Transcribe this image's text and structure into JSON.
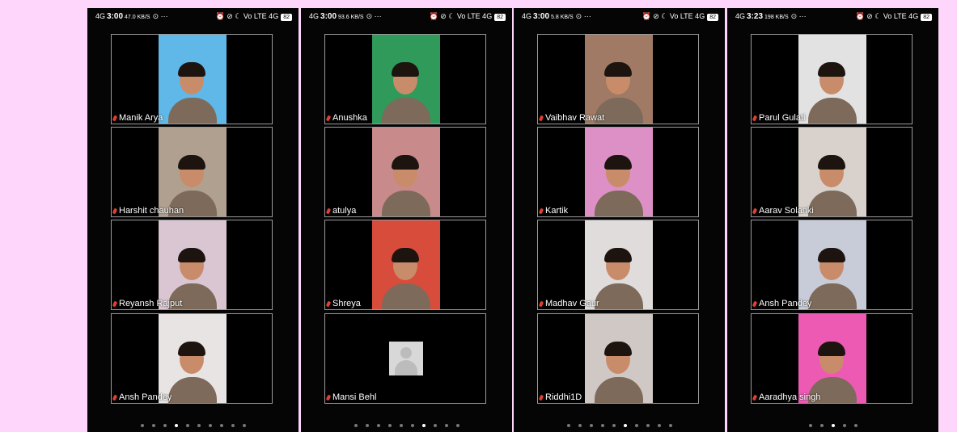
{
  "screens": [
    {
      "status": {
        "network": "4G",
        "time": "3:00",
        "speed": "47.0 KB/S",
        "extra": "⊙ ···",
        "right_icons": "⏰ ⊘ ☾ Vo LTE 4G",
        "battery": "82"
      },
      "tiles": [
        {
          "name": "Manik  Arya",
          "bg": "#5fb8e8"
        },
        {
          "name": "Harshit chauhan",
          "bg": "#b0a090"
        },
        {
          "name": "Reyansh Rajput",
          "bg": "#d9c6d2"
        },
        {
          "name": "Ansh Pandey",
          "bg": "#e8e4e4"
        }
      ],
      "dots": {
        "count": 10,
        "active": 3
      }
    },
    {
      "status": {
        "network": "4G",
        "time": "3:00",
        "speed": "93.6 KB/S",
        "extra": "⊙ ···",
        "right_icons": "⏰ ⊘ ☾ Vo LTE 4G",
        "battery": "82"
      },
      "tiles": [
        {
          "name": "Anushka",
          "bg": "#2f9a5a"
        },
        {
          "name": "atulya",
          "bg": "#c88a8a"
        },
        {
          "name": "Shreya",
          "bg": "#d84c3c"
        },
        {
          "name": "Mansi Behl",
          "bg": null
        }
      ],
      "dots": {
        "count": 10,
        "active": 6
      }
    },
    {
      "status": {
        "network": "4G",
        "time": "3:00",
        "speed": "5.8 KB/S",
        "extra": "⊙ ···",
        "right_icons": "⏰ ⊘ ☾ Vo LTE 4G",
        "battery": "82"
      },
      "tiles": [
        {
          "name": "Vaibhav Rawat",
          "bg": "#a07a64"
        },
        {
          "name": "Kartik",
          "bg": "#dd90c6"
        },
        {
          "name": "Madhav Gaur",
          "bg": "#e0dcdc"
        },
        {
          "name": "Riddhi1D",
          "bg": "#cfc8c4"
        }
      ],
      "dots": {
        "count": 10,
        "active": 5
      }
    },
    {
      "status": {
        "network": "4G",
        "time": "3:23",
        "speed": "198 KB/S",
        "extra": "⊙ ···",
        "right_icons": "⏰ ⊘ ☾ Vo LTE 4G",
        "battery": "82"
      },
      "tiles": [
        {
          "name": "Parul Gulati",
          "bg": "#e2e2e2"
        },
        {
          "name": "Aarav Solanki",
          "bg": "#d9d2cc"
        },
        {
          "name": "Ansh Pandey",
          "bg": "#c8ccd8"
        },
        {
          "name": "Aaradhya singh",
          "bg": "#ec5ab4"
        }
      ],
      "dots": {
        "count": 5,
        "active": 2
      }
    }
  ]
}
